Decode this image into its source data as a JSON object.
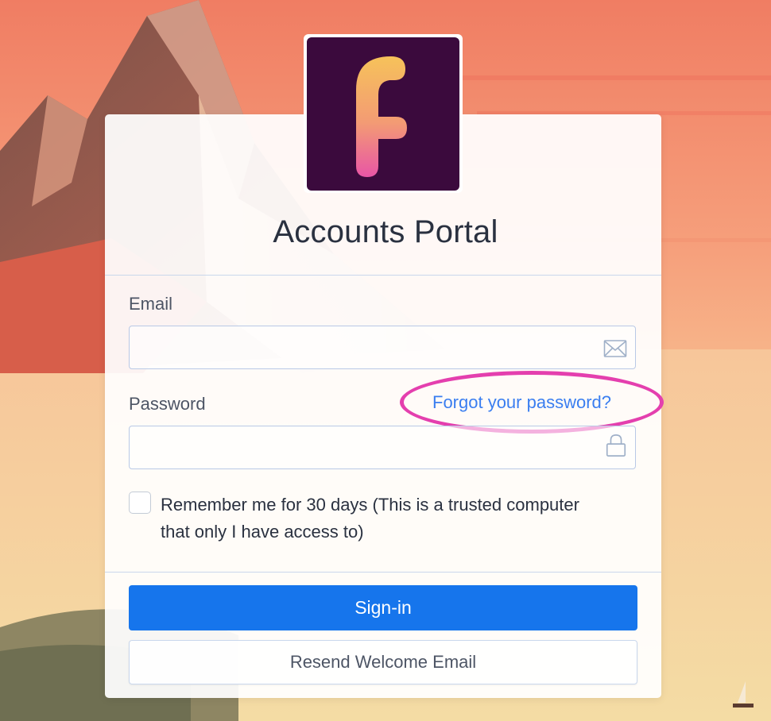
{
  "app": {
    "title": "Accounts Portal",
    "logo_letter": "f",
    "accent_color": "#1675ec",
    "highlight_color": "#e43fae"
  },
  "form": {
    "email": {
      "label": "Email",
      "value": "",
      "placeholder": "",
      "icon": "envelope-icon"
    },
    "password": {
      "label": "Password",
      "value": "",
      "placeholder": "",
      "icon": "lock-icon",
      "forgot_link": "Forgot your password?"
    },
    "remember": {
      "label": "Remember me for 30 days (This is a trusted computer that only I have access to)",
      "checked": false
    }
  },
  "buttons": {
    "signin_label": "Sign-in",
    "resend_label": "Resend Welcome Email"
  }
}
